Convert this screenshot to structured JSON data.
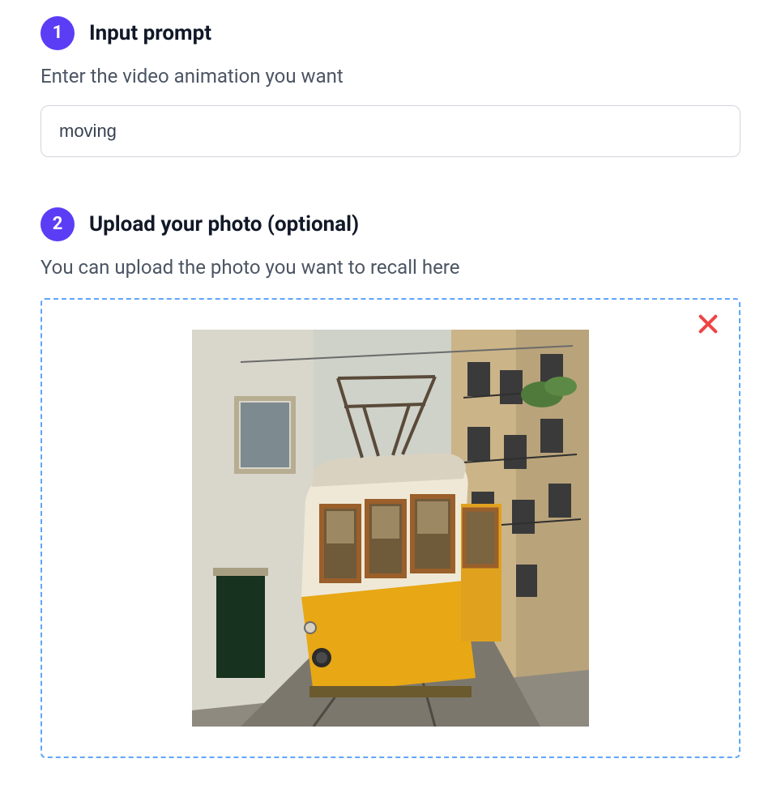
{
  "step1": {
    "badge": "1",
    "title": "Input prompt",
    "desc": "Enter the video animation you want",
    "prompt_value": "moving"
  },
  "step2": {
    "badge": "2",
    "title": "Upload your photo (optional)",
    "desc": "You can upload the photo you want to recall here",
    "has_preview": true,
    "preview_alt": "Yellow tram on a cobblestone street between old buildings"
  },
  "icons": {
    "close": "close-icon"
  },
  "colors": {
    "accent": "#5b3df5",
    "upload_border": "#60a5fa",
    "close": "#ef4444"
  }
}
